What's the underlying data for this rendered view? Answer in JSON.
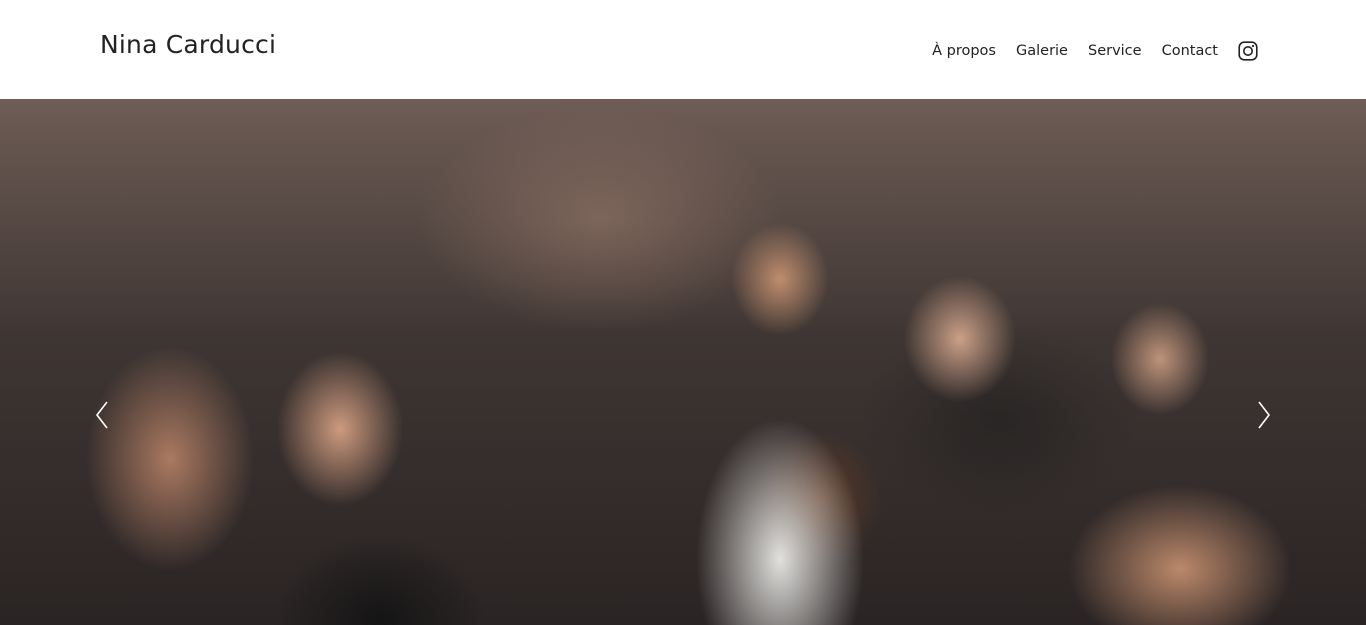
{
  "header": {
    "brand": "Nina Carducci",
    "nav": [
      {
        "label": "À propos"
      },
      {
        "label": "Galerie"
      },
      {
        "label": "Service"
      },
      {
        "label": "Contact"
      }
    ],
    "social_icon": "instagram-icon"
  },
  "hero": {
    "image_description": "concert crowd",
    "prev_icon": "chevron-left-icon",
    "next_icon": "chevron-right-icon"
  },
  "colors": {
    "header_bg": "#ffffff",
    "text": "#222222",
    "arrow": "#ffffff"
  }
}
